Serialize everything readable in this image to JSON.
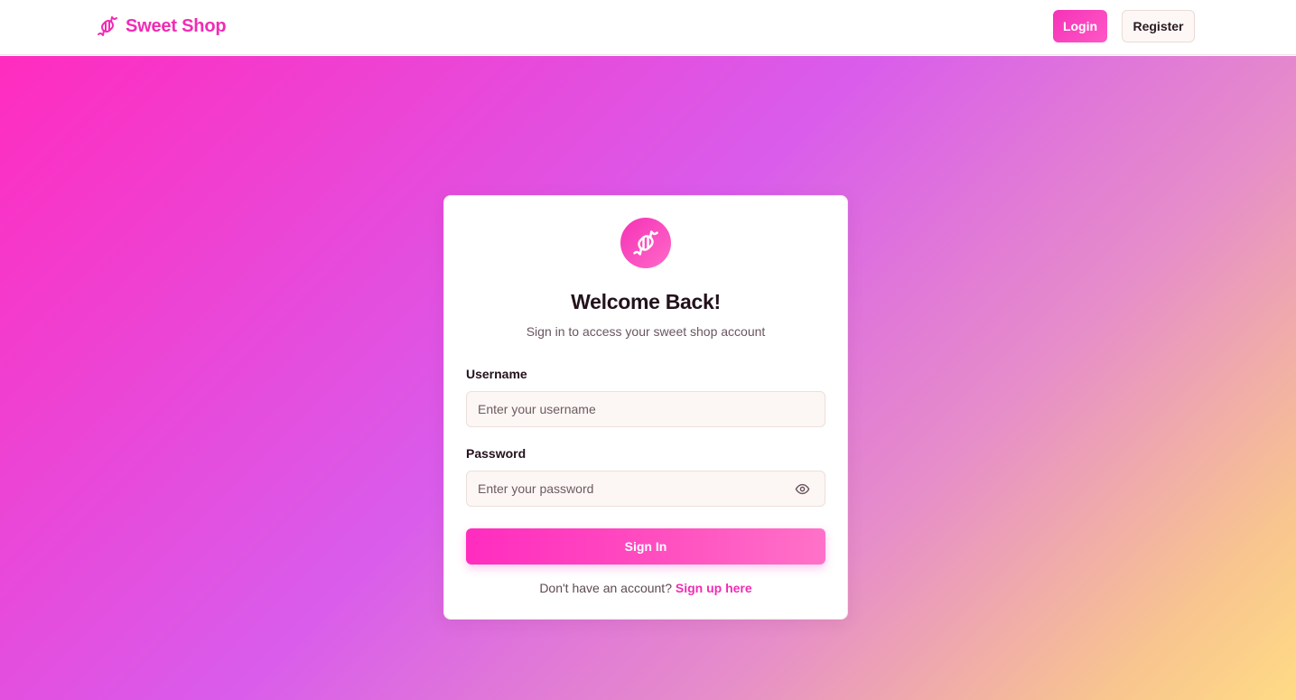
{
  "nav": {
    "brand_name": "Sweet Shop",
    "brand_icon": "candy-icon",
    "login_label": "Login",
    "register_label": "Register"
  },
  "card": {
    "icon": "candy-icon",
    "title": "Welcome Back!",
    "subtitle": "Sign in to access your sweet shop account",
    "username_label": "Username",
    "username_placeholder": "Enter your username",
    "username_value": "",
    "password_label": "Password",
    "password_placeholder": "Enter your password",
    "password_value": "",
    "password_toggle_icon": "eye-icon",
    "submit_label": "Sign In",
    "footer_prefix": "Don't have an account?",
    "signup_link": "Sign up here"
  },
  "colors": {
    "accent": "#f02cb4",
    "gradient_start": "#ff2cbf",
    "gradient_mid": "#d95ceb",
    "gradient_end": "#ffdb85"
  }
}
